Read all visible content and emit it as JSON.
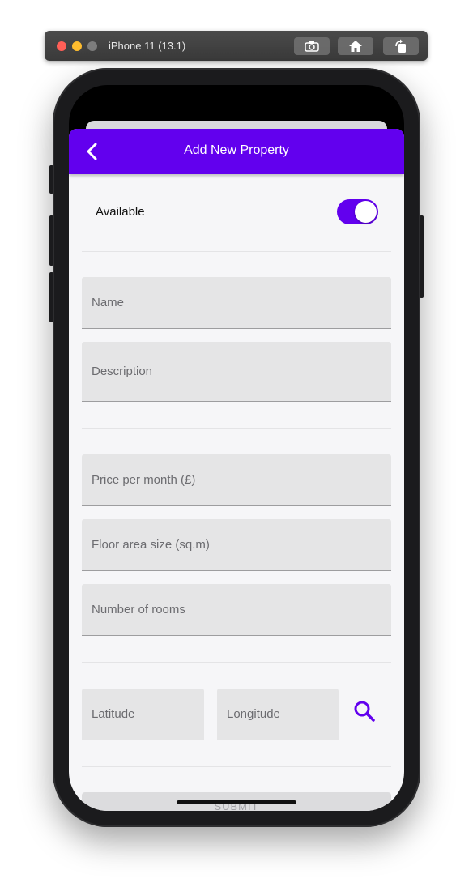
{
  "simulator": {
    "title": "iPhone 11 (13.1)",
    "buttons": [
      "screenshot-icon",
      "home-icon",
      "rotate-icon"
    ]
  },
  "appbar": {
    "title": "Add New Property",
    "back_icon": "chevron-left-icon",
    "color": "#6200ee"
  },
  "available": {
    "label": "Available",
    "toggle_on": true
  },
  "fields": {
    "name": {
      "placeholder": "Name",
      "value": ""
    },
    "description": {
      "placeholder": "Description",
      "value": ""
    },
    "price": {
      "placeholder": "Price per month (£)",
      "value": ""
    },
    "floor_area": {
      "placeholder": "Floor area size (sq.m)",
      "value": ""
    },
    "rooms": {
      "placeholder": "Number of rooms",
      "value": ""
    },
    "latitude": {
      "placeholder": "Latitude",
      "value": ""
    },
    "longitude": {
      "placeholder": "Longitude",
      "value": ""
    }
  },
  "search_icon": "search-icon",
  "submit": {
    "label": "SUBMIT"
  }
}
